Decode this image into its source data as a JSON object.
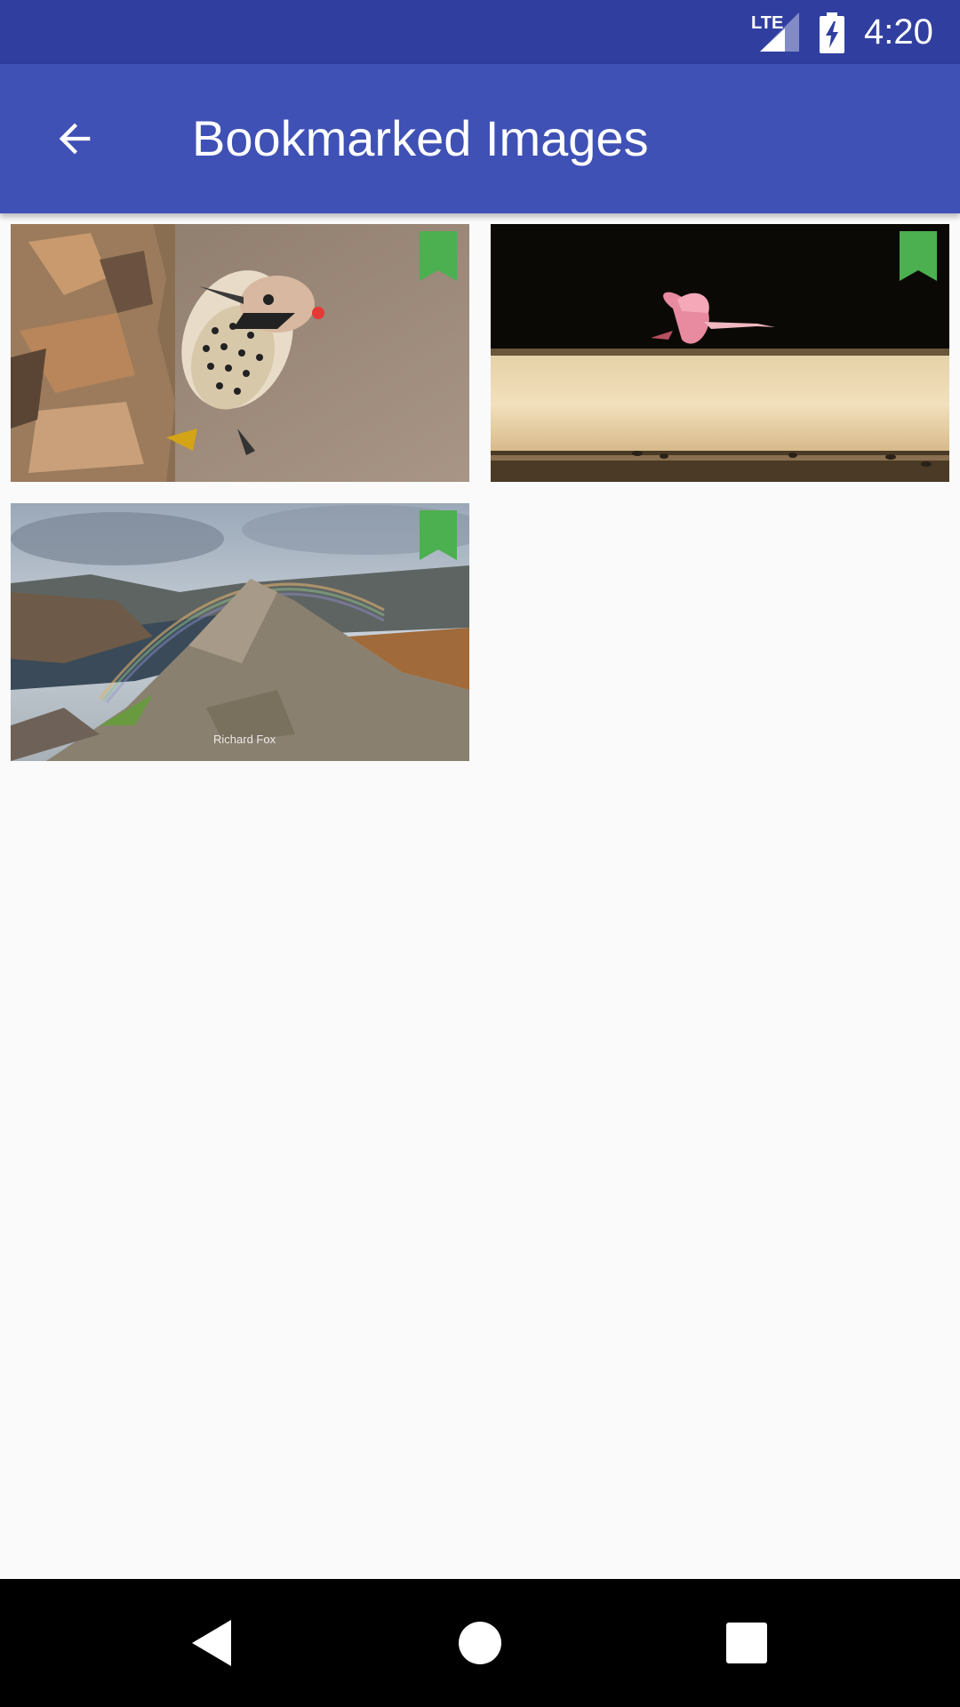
{
  "status_bar": {
    "network": "LTE",
    "time": "4:20"
  },
  "app_bar": {
    "title": "Bookmarked Images",
    "back_icon": "arrow-back-icon"
  },
  "images": [
    {
      "subject": "woodpecker",
      "bookmarked": true,
      "bookmark_color": "#4caf50"
    },
    {
      "subject": "flamingo-flying",
      "bookmarked": true,
      "bookmark_color": "#4caf50"
    },
    {
      "subject": "mountain-rainbow",
      "bookmarked": true,
      "bookmark_color": "#4caf50",
      "watermark": "Richard Fox"
    }
  ],
  "nav_bar": {
    "back_icon": "nav-back-icon",
    "home_icon": "nav-home-icon",
    "recent_icon": "nav-recents-icon"
  },
  "colors": {
    "status_bar": "#303f9f",
    "app_bar": "#3f51b5",
    "bookmark": "#4caf50",
    "background": "#fafafa"
  }
}
